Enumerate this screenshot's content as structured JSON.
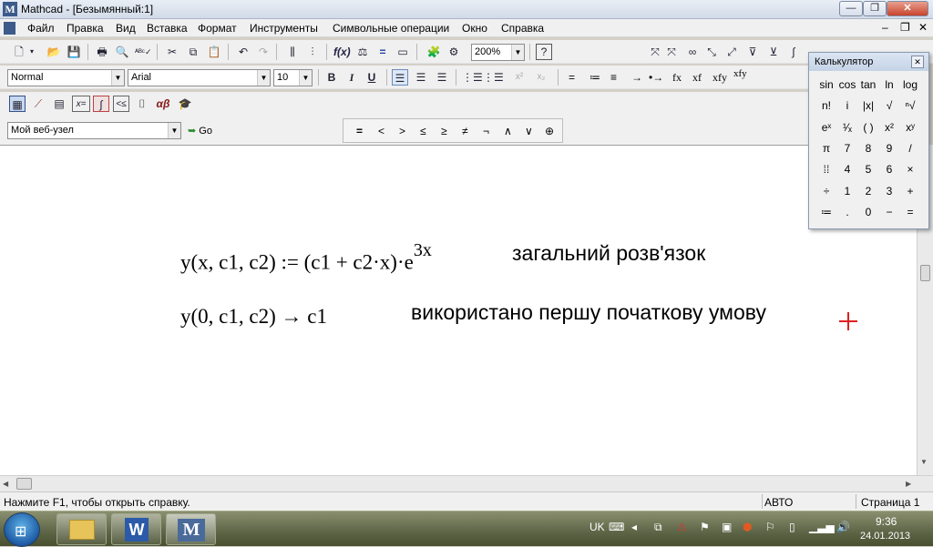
{
  "window": {
    "title": "Mathcad - [Безымянный:1]",
    "app_icon": "M"
  },
  "menu": [
    "Файл",
    "Правка",
    "Вид",
    "Вставка",
    "Формат",
    "Инструменты",
    "Символьные операции",
    "Окно",
    "Справка"
  ],
  "toolbar": {
    "zoom": "200%"
  },
  "format_bar": {
    "style": "Normal",
    "font": "Arial",
    "size": "10"
  },
  "format_glyphs": {
    "bold": "B",
    "italic": "I",
    "underline": "U"
  },
  "symbolic_glyphs": [
    "=",
    "≔",
    "≡",
    "→",
    "•→",
    "fx",
    "xf",
    "xfy",
    "xfy"
  ],
  "web_bar": {
    "url": "Мой веб-узел",
    "go": "Go"
  },
  "boolean_ops": [
    "=",
    "<",
    ">",
    "≤",
    "≥",
    "≠",
    "¬",
    "∧",
    "∨",
    "⊕"
  ],
  "document": {
    "eq1_lhs": "y(x, c1, c2) := (c1 + c2·x)·e",
    "eq1_exp": "3x",
    "note1": "загальний розв'язок",
    "eq2": "y(0, c1, c2) → c1",
    "note2": "використано першу початкову умову"
  },
  "calculator": {
    "title": "Калькулятор",
    "rows": [
      [
        "sin",
        "cos",
        "tan",
        "ln",
        "log"
      ],
      [
        "n!",
        "i",
        "|x|",
        "√",
        "ⁿ√"
      ],
      [
        "eˣ",
        "¹⁄ₓ",
        "( )",
        "x²",
        "xʸ"
      ],
      [
        "π",
        "7",
        "8",
        "9",
        "/"
      ],
      [
        "⁞⁞",
        "4",
        "5",
        "6",
        "×"
      ],
      [
        "÷",
        "1",
        "2",
        "3",
        "+"
      ],
      [
        "≔",
        ".",
        "0",
        "−",
        "="
      ]
    ]
  },
  "status": {
    "help": "Нажмите F1, чтобы открыть справку.",
    "mode": "АВТО",
    "page": "Страница 1"
  },
  "taskbar": {
    "lang": "UK",
    "time": "9:36",
    "date": "24.01.2013"
  }
}
